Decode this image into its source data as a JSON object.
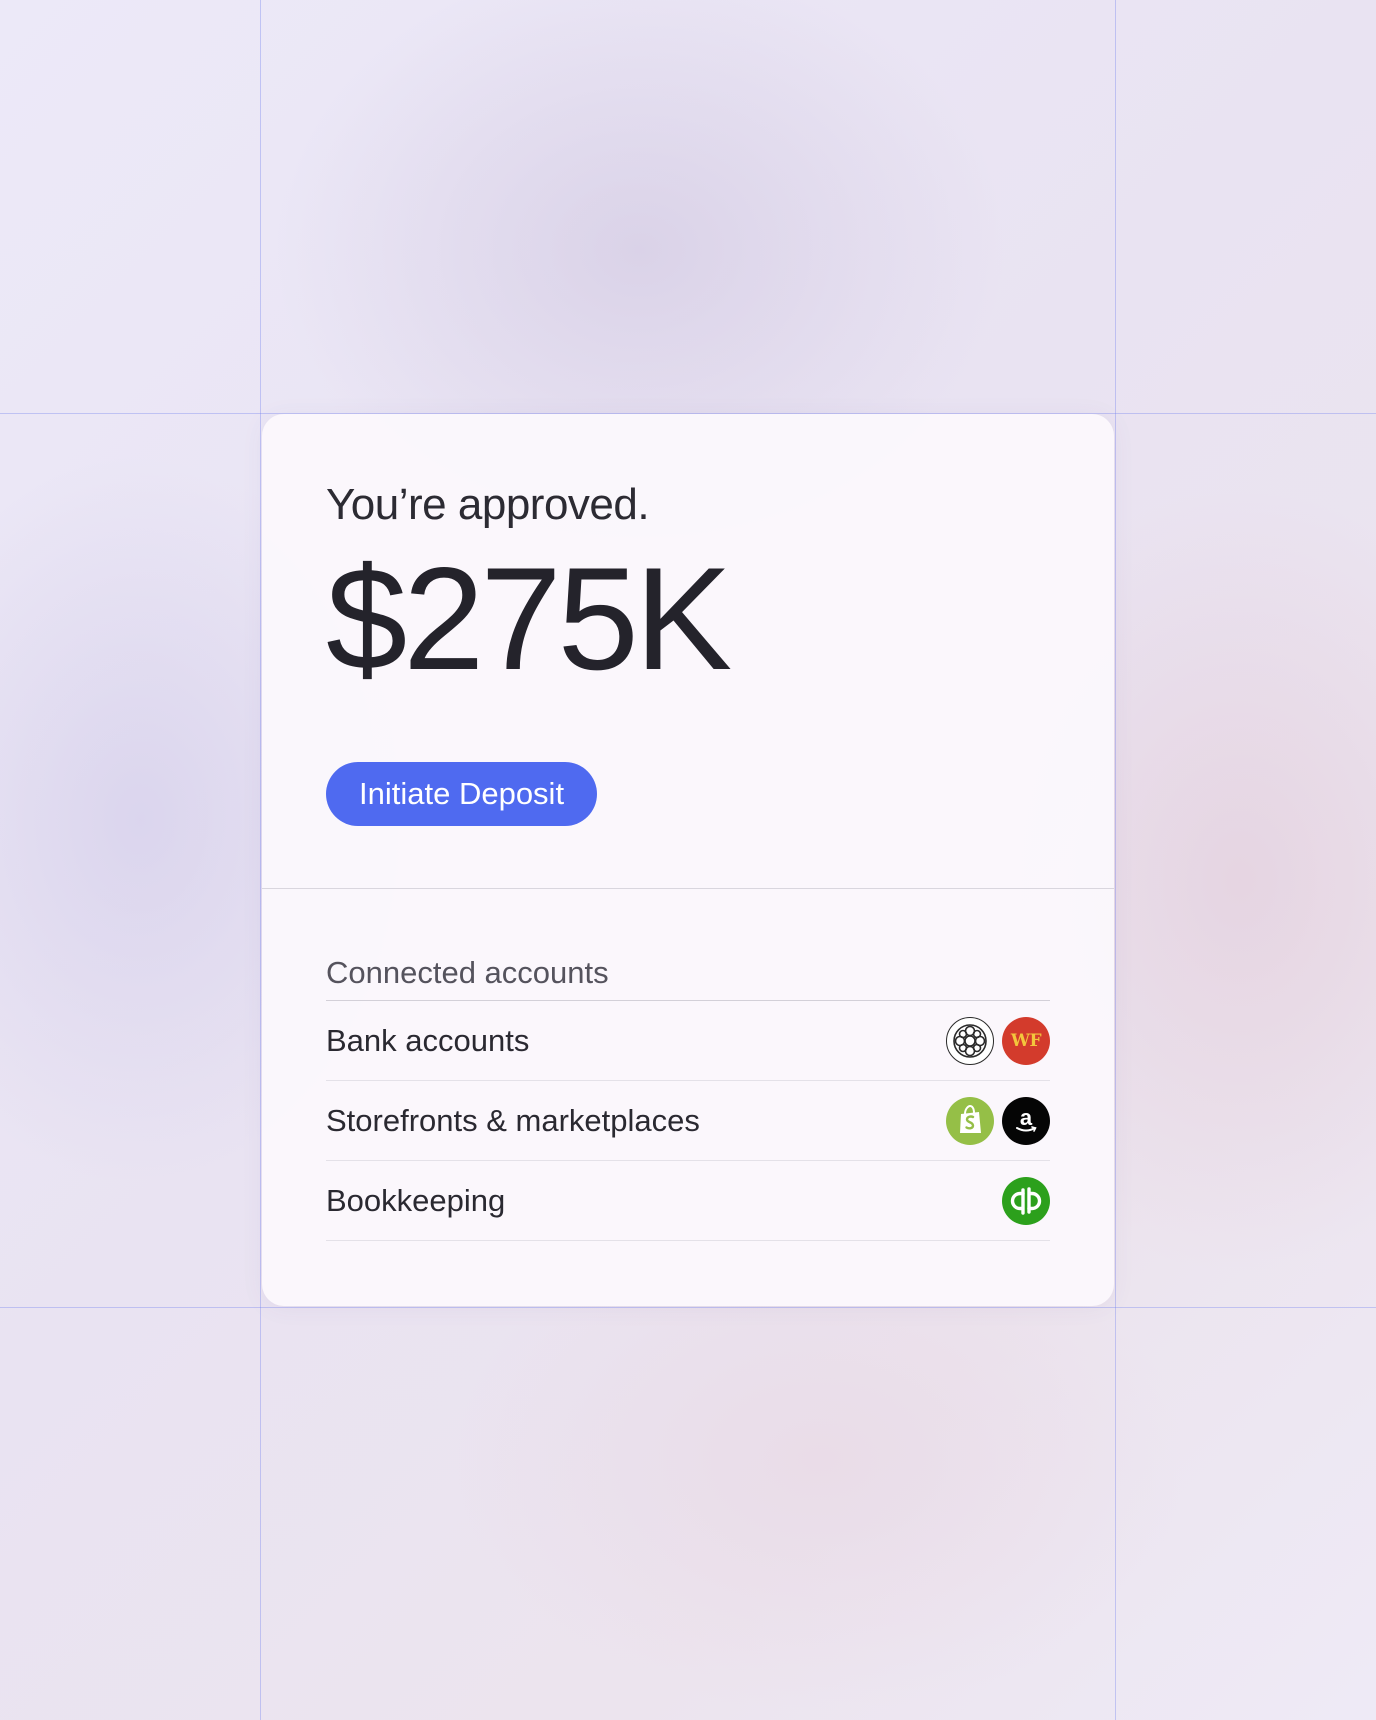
{
  "card": {
    "approval_text": "You’re approved.",
    "amount": "$275K",
    "deposit_button_label": "Initiate Deposit"
  },
  "accounts": {
    "heading": "Connected accounts",
    "rows": [
      {
        "label": "Bank accounts",
        "logos": [
          "bank-seal-icon",
          "wells-fargo-icon"
        ],
        "logo_text": [
          "",
          "WF"
        ]
      },
      {
        "label": "Storefronts & marketplaces",
        "logos": [
          "shopify-icon",
          "amazon-icon"
        ],
        "logo_text": [
          "",
          "a"
        ]
      },
      {
        "label": "Bookkeeping",
        "logos": [
          "quickbooks-icon"
        ],
        "logo_text": [
          ""
        ]
      }
    ]
  },
  "colors": {
    "accent": "#4f6af0",
    "wells_fargo": "#d33b2c",
    "shopify": "#95bf47",
    "amazon": "#050505",
    "quickbooks": "#2ca01c"
  }
}
